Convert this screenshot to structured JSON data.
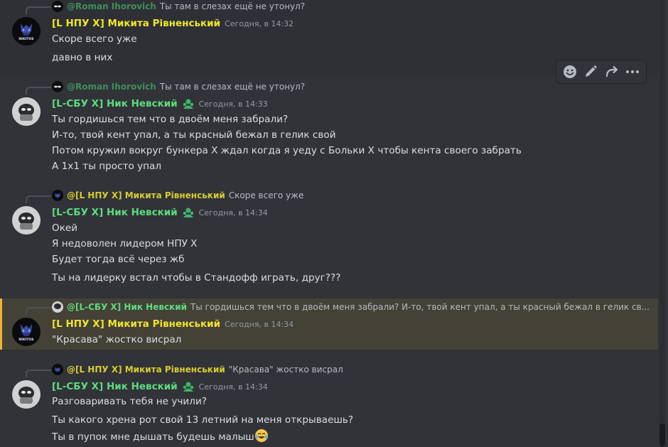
{
  "messages": [
    {
      "reply": {
        "author": "@Roman Ihorovich",
        "text": "Ты там в слезах ещё не утонул?"
      },
      "author": "[L НПУ X] Микита Рівненський",
      "timestamp": "Сегодня, в 14:32",
      "lines": [
        "Скоре всего уже",
        "давно в них"
      ]
    },
    {
      "reply": {
        "author": "@Roman Ihorovich",
        "text": "Ты там в слезах ещё не утонул?"
      },
      "author": "[L-СБУ X] Ник Невский",
      "timestamp": "Сегодня, в 14:33",
      "lines": [
        "Ты гордишься тем что в двоём меня забрали?",
        "И-то, твой кент упал, а ты красный бежал в гелик свой",
        "Потом кружил вокруг бункера X ждал когда я уеду с Больки X чтобы кента своего забрать",
        "А 1x1 ты просто упал"
      ]
    },
    {
      "reply": {
        "author": "@[L НПУ X] Микита Рівненський",
        "text": "Скоре всего уже"
      },
      "author": "[L-СБУ X] Ник Невский",
      "timestamp": "Сегодня, в 14:34",
      "lines": [
        "Окей",
        "Я недоволен лидером НПУ X",
        "Будет тогда всё через жб",
        "Ты на лидерку встал чтобы в Стандофф играть, друг???"
      ]
    },
    {
      "reply": {
        "author": "@[L-СБУ X] Ник Невский",
        "text": "Ты гордишься тем что в двоём меня забрали?  И-то, твой кент упал, а ты красный бежал в гелик св..."
      },
      "author": "[L НПУ X] Микита Рівненський",
      "timestamp": "Сегодня, в 14:34",
      "lines": [
        "\"Красава\" жостко висрал"
      ]
    },
    {
      "reply": {
        "author": "@[L НПУ X] Микита Рівненський",
        "text": "\"Красава\" жостко висрал"
      },
      "author": "[L-СБУ X] Ник Невский",
      "timestamp": "Сегодня, в 14:34",
      "lines": [
        "Разговаривать тебя не учили?",
        "Ты какого хрена рот свой 13 летний на меня открываешь?",
        "Ты в пупок мне дышать будешь малыш"
      ]
    }
  ],
  "toolbar": {
    "icons": [
      "smile-icon",
      "edit-icon",
      "reply-icon",
      "more-icon"
    ]
  },
  "avatar_text": {
    "nikitos": "NIKITOS"
  },
  "colors": {
    "background": "#313338",
    "hover": "#2e3035",
    "highlight": "#444137",
    "highlight_bar": "#f0b232",
    "name_yellow": "#f0e52a",
    "reply_roman": "#3f8f5c",
    "reply_yellow": "#d8cc2e",
    "reply_green": "#5ddb7f"
  }
}
